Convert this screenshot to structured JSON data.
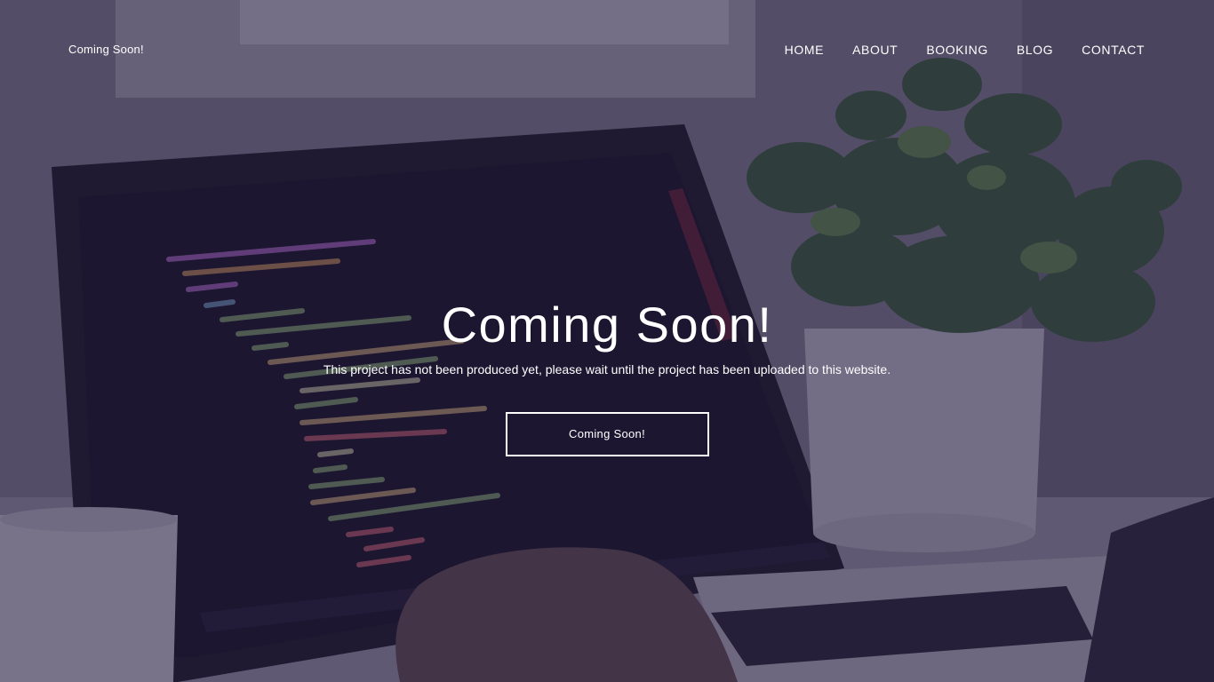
{
  "site": {
    "brand": "Coming Soon!"
  },
  "nav": {
    "items": [
      {
        "label": "HOME"
      },
      {
        "label": "ABOUT"
      },
      {
        "label": "BOOKING"
      },
      {
        "label": "BLOG"
      },
      {
        "label": "CONTACT"
      }
    ]
  },
  "hero": {
    "title": "Coming Soon!",
    "subtitle": "This project has not been produced yet, please wait until the project has been uploaded to this website.",
    "button_label": "Coming Soon!"
  },
  "colors": {
    "overlay": "#221a3e",
    "text": "#ffffff",
    "plant": "#3f6b3a",
    "pot": "#d6d4dc",
    "screen": "#15121f"
  }
}
